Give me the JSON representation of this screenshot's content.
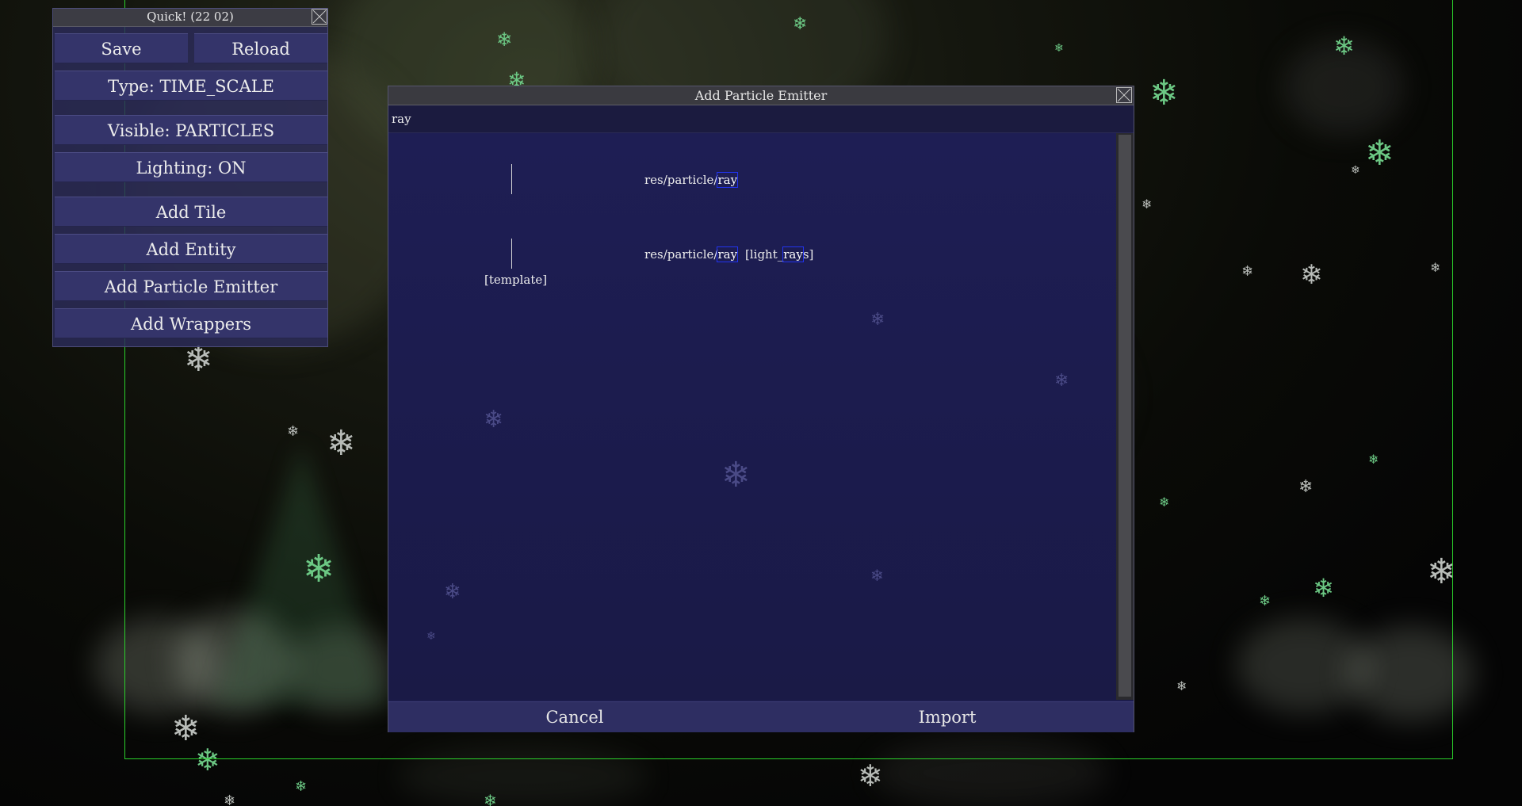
{
  "quick_panel": {
    "title": "Quick! (22 02)",
    "save_label": "Save",
    "reload_label": "Reload",
    "type_label": "Type: TIME_SCALE",
    "visible_label": "Visible: PARTICLES",
    "lighting_label": "Lighting: ON",
    "add_tile_label": "Add Tile",
    "add_entity_label": "Add Entity",
    "add_particle_emitter_label": "Add Particle Emitter",
    "add_wrappers_label": "Add Wrappers"
  },
  "dialog": {
    "title": "Add Particle Emitter",
    "search_value": "ray",
    "items": [
      {
        "path_prefix": "res/particle/",
        "path_match": "ray",
        "tag_open": "",
        "tag_match": "",
        "tag_close": "",
        "label": ""
      },
      {
        "path_prefix": "res/particle/",
        "path_match": "ray",
        "tag_open": "[light_",
        "tag_match": "ray",
        "tag_close": "s]",
        "label": "[template]"
      }
    ],
    "cancel_label": "Cancel",
    "import_label": "Import"
  },
  "colors": {
    "level_border": "#2bd12b",
    "dialog_bg": "#1c1c4c",
    "button_bg": "#34346a",
    "match_highlight": "#2233ee"
  },
  "icons": {
    "close": "close-icon",
    "snowflake": "snowflake-icon"
  }
}
